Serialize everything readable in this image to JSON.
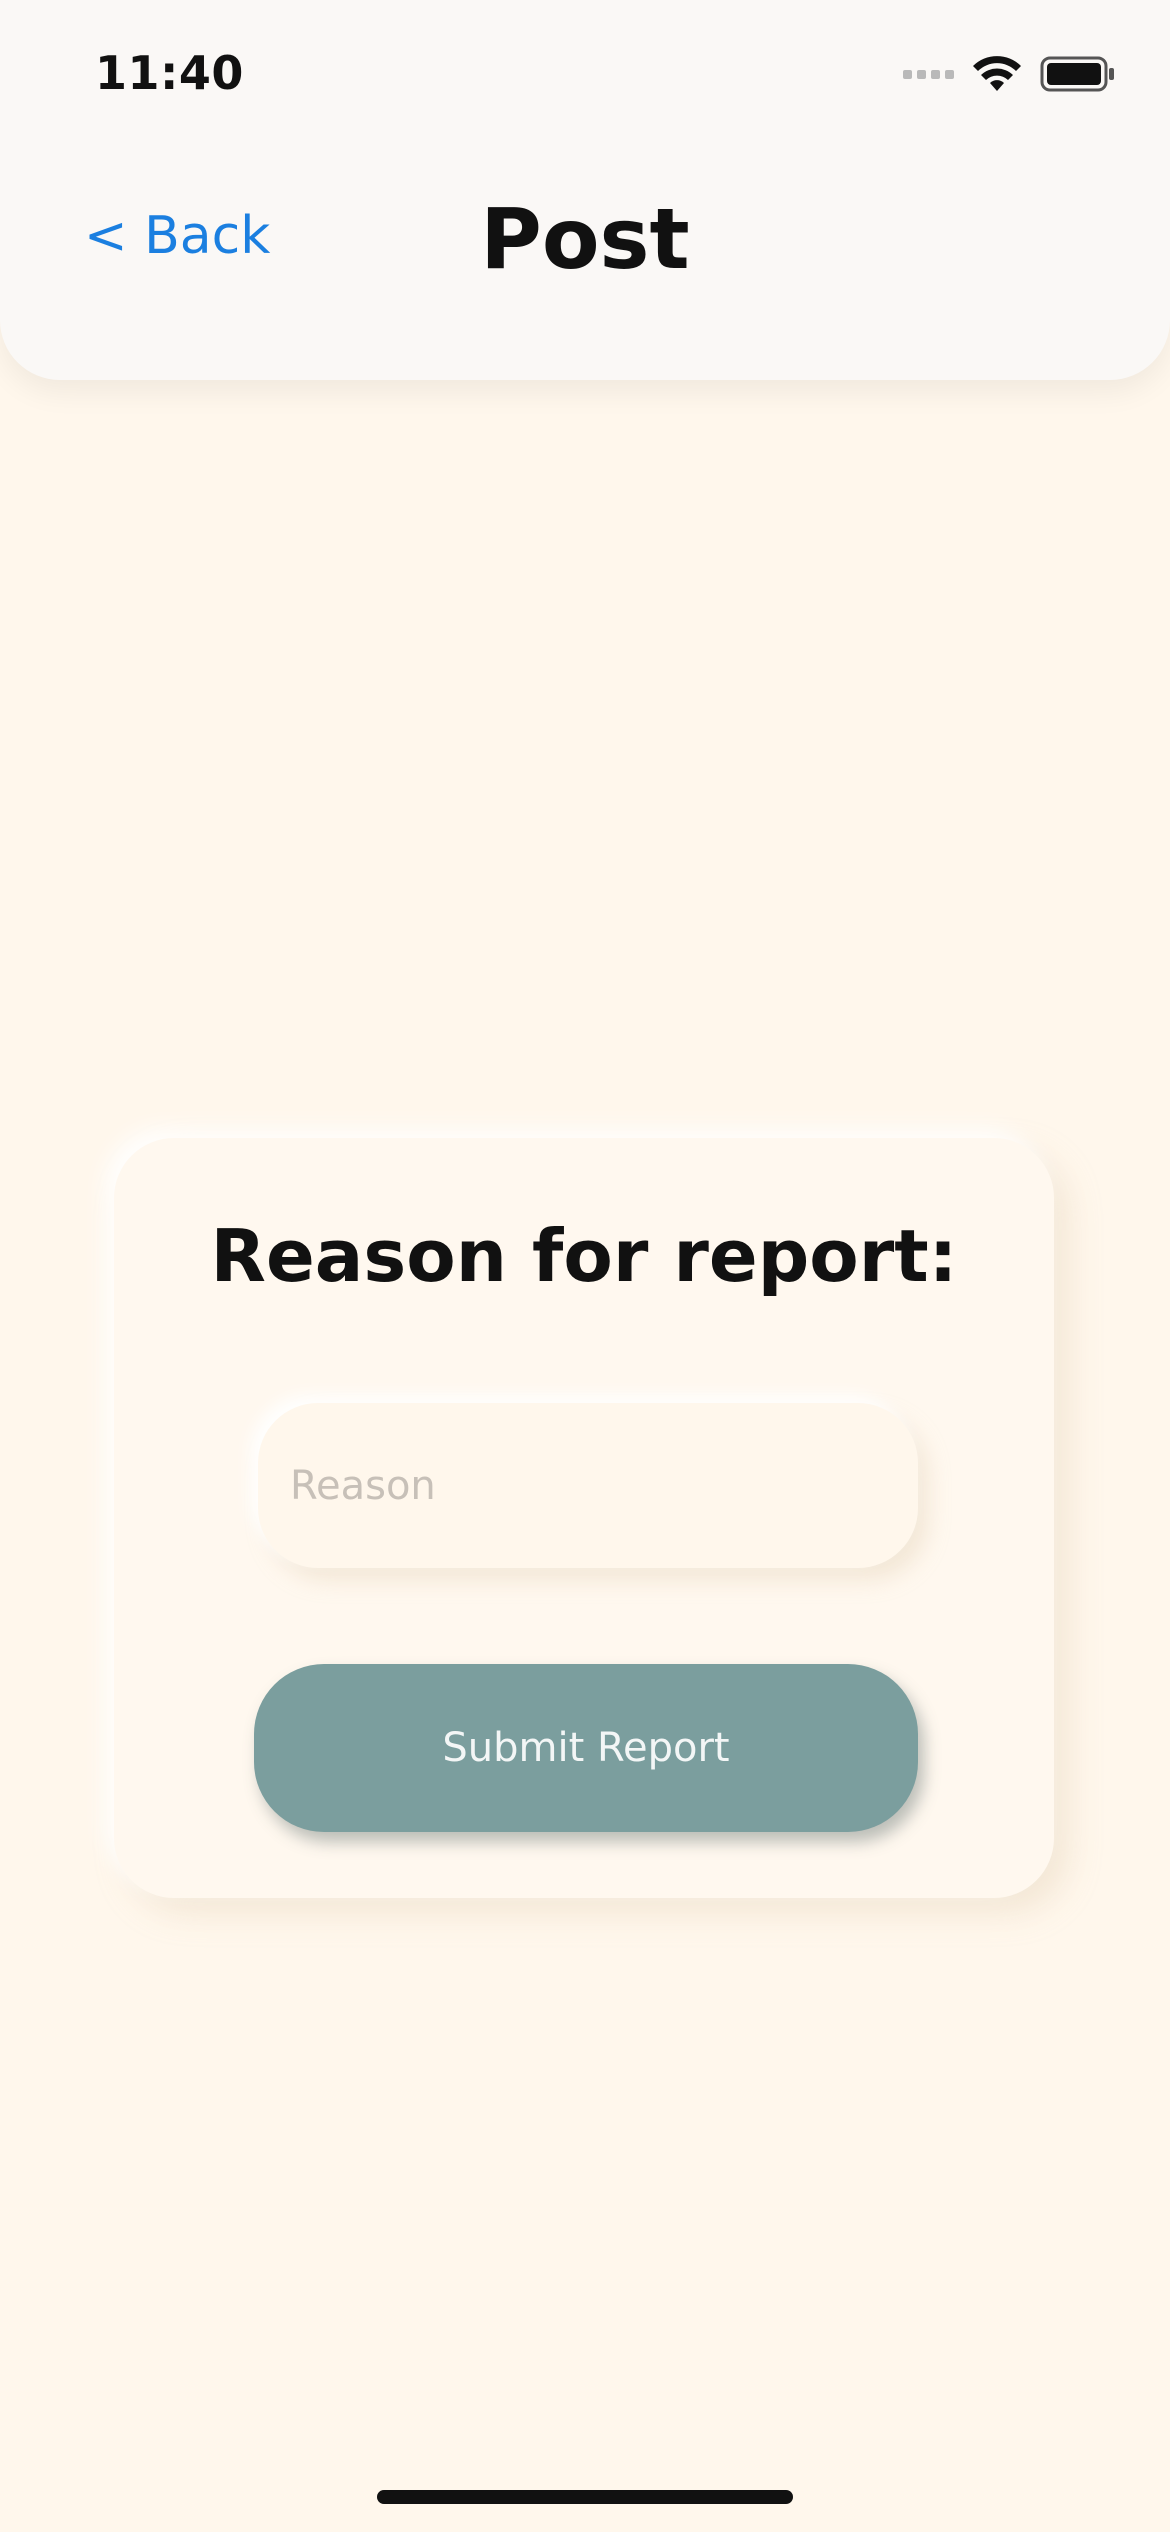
{
  "status_bar": {
    "time": "11:40",
    "icons": [
      "cellular-signal-icon",
      "wifi-icon",
      "battery-icon"
    ]
  },
  "header": {
    "back_label": "< Back",
    "title": "Post"
  },
  "report_card": {
    "title": "Reason for report:",
    "reason_input": {
      "placeholder": "Reason",
      "value": ""
    },
    "submit_label": "Submit Report"
  },
  "colors": {
    "background": "#fff7ec",
    "header_background": "#faf8f6",
    "accent_link": "#1b7fe0",
    "button": "#7b9e9e",
    "button_text": "#f3f6f6",
    "placeholder": "#c7c0b8"
  }
}
